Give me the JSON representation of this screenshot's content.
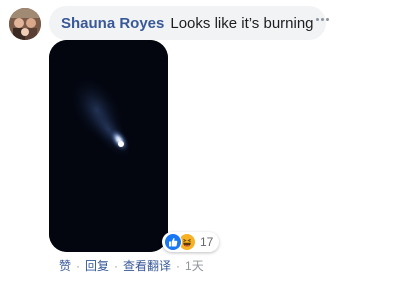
{
  "comment": {
    "author": "Shauna Royes",
    "text": "Looks like it’s burning",
    "reactions": {
      "icons": [
        "like-icon",
        "haha-icon"
      ],
      "count": "17"
    },
    "actions": {
      "like": "赞",
      "reply": "回复",
      "translate": "查看翻译",
      "separator": "·",
      "time": "1天"
    }
  },
  "colors": {
    "author_link": "#385898",
    "bubble_bg": "#f2f3f5",
    "like_blue": "#1877f2",
    "haha_yellow": "#f7b125",
    "meta_gray": "#90949c"
  }
}
